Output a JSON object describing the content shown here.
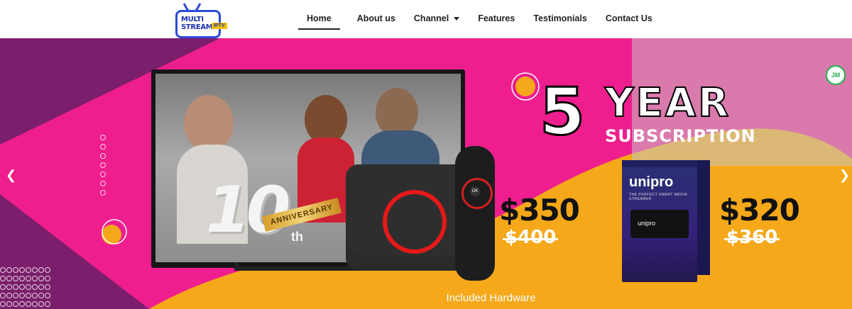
{
  "logo": {
    "line1": "MULTI",
    "line2": "STREAM",
    "badge": "IPTV"
  },
  "nav": {
    "items": [
      {
        "label": "Home",
        "active": true
      },
      {
        "label": "About us"
      },
      {
        "label": "Channel",
        "has_dropdown": true
      },
      {
        "label": "Features"
      },
      {
        "label": "Testimonials"
      },
      {
        "label": "Contact Us"
      }
    ]
  },
  "hero": {
    "headline_number": "5",
    "headline_word": "YEAR",
    "headline_sub": "SUBSCRIPTION",
    "anniversary_number": "10",
    "anniversary_label": "ANNIVERSARY",
    "anniversary_suffix": "th",
    "offer1": {
      "price": "$350",
      "old_price": "$400"
    },
    "offer2": {
      "price": "$320",
      "old_price": "$360"
    },
    "unipro_brand": "unipro",
    "unipro_tagline": "THE PERFECT SMART MEDIA STREAMER",
    "unipro_device_label": "unipro",
    "caption": "Included Hardware",
    "badge": "JM",
    "prev_icon": "chevron-left-icon",
    "next_icon": "chevron-right-icon",
    "colors": {
      "pink": "#ee1e8e",
      "purple": "#7b1e6c",
      "orange": "#f4a81a",
      "ring": "#e41a1a"
    }
  }
}
